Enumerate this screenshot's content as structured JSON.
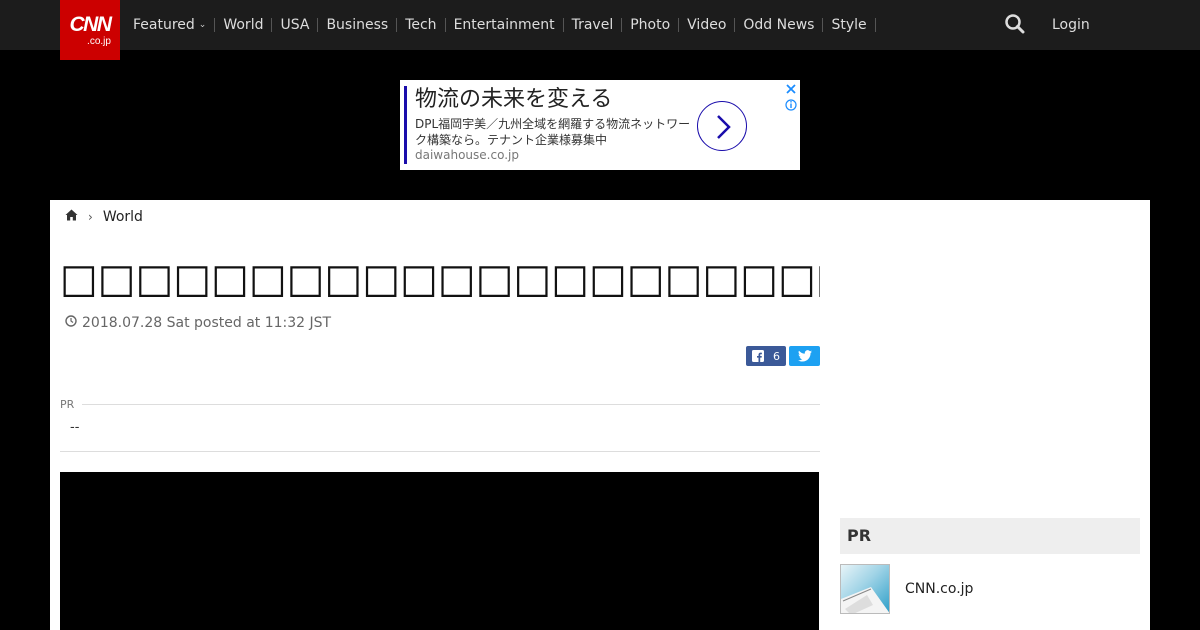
{
  "logo": {
    "brand": "CNN",
    "suffix": ".co.jp"
  },
  "nav": {
    "items": [
      {
        "label": "Featured",
        "has_dropdown": true
      },
      {
        "label": "World"
      },
      {
        "label": "USA"
      },
      {
        "label": "Business"
      },
      {
        "label": "Tech"
      },
      {
        "label": "Entertainment"
      },
      {
        "label": "Travel"
      },
      {
        "label": "Photo"
      },
      {
        "label": "Video"
      },
      {
        "label": "Odd News"
      },
      {
        "label": "Style"
      }
    ],
    "search_icon": "search-icon",
    "login_label": "Login"
  },
  "ad": {
    "headline": "物流の未来を変える",
    "body": "DPL福岡宇美／九州全域を網羅する物流ネットワーク構築なら。テナント企業様募集中",
    "domain": "daiwahouse.co.jp"
  },
  "breadcrumb": {
    "home_icon": "home-icon",
    "section": "World"
  },
  "article": {
    "title": "□□□□□□□□□□□□□□□□□□□□□□□□□□□□□□□□□□□□□□",
    "date": "2018.07.28 Sat posted at 11:32 JST",
    "share": {
      "facebook_count": "6"
    },
    "pr_label": "PR",
    "pr_value": "--"
  },
  "sidebar": {
    "pr_header": "PR",
    "item_label": "CNN.co.jp"
  },
  "colors": {
    "brand_red": "#cc0000",
    "nav_bg": "#1c1c1c",
    "facebook": "#3b5998",
    "twitter": "#1da1f2"
  }
}
